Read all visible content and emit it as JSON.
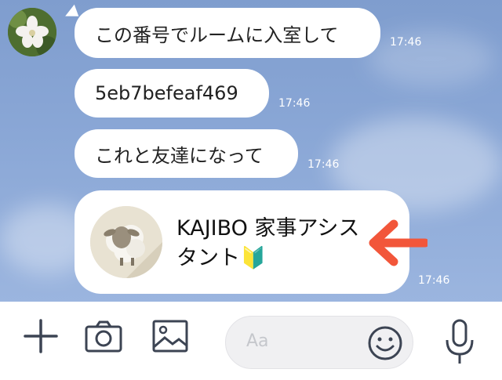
{
  "messages": [
    {
      "text": "この番号でルームに入室して",
      "time": "17:46"
    },
    {
      "text": "5eb7befeaf469",
      "time": "17:46"
    },
    {
      "text": "これと友達になって",
      "time": "17:46"
    }
  ],
  "contact_card": {
    "name": "KAJIBO 家事アシスタント🔰",
    "time": "17:46"
  },
  "input": {
    "placeholder": "Aa"
  },
  "colors": {
    "chat_background": "#8aa7d6",
    "bubble": "#ffffff",
    "arrow": "#f2563a",
    "toolbar_icons": "#3c4453"
  },
  "icons": [
    "plus-icon",
    "camera-icon",
    "image-icon",
    "emoji-icon",
    "microphone-icon"
  ]
}
